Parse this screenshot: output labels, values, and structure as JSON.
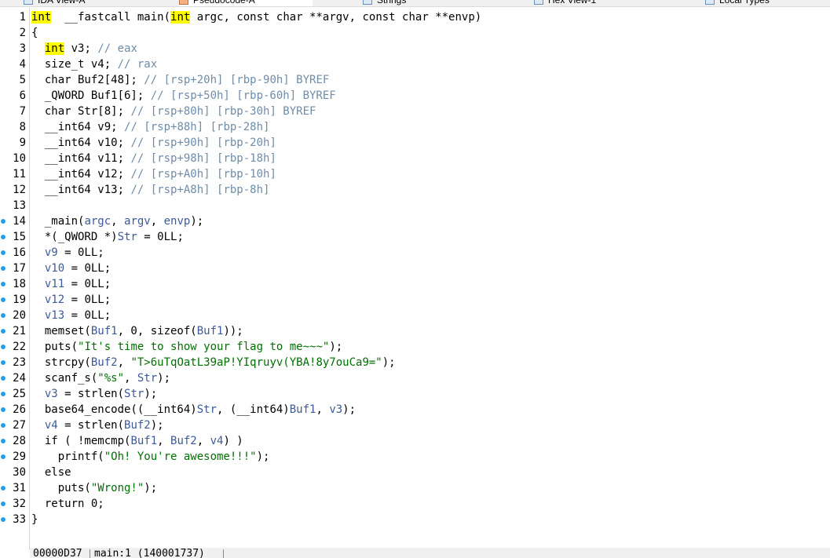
{
  "tabs": [
    {
      "label": "IDA View-A",
      "active": false
    },
    {
      "label": "Pseudocode-A",
      "active": true
    },
    {
      "label": "Strings",
      "active": false
    },
    {
      "label": "Hex View-1",
      "active": false
    },
    {
      "label": "Local Types",
      "active": false
    }
  ],
  "code": {
    "lines": [
      {
        "n": "1",
        "bp": false,
        "segs": [
          [
            "hl",
            "int"
          ],
          [
            "",
            "  __fastcall main("
          ],
          [
            "hl",
            "int"
          ],
          [
            "",
            " argc, const char **argv, const char **envp)"
          ]
        ]
      },
      {
        "n": "2",
        "bp": false,
        "segs": [
          [
            "",
            "{"
          ]
        ]
      },
      {
        "n": "3",
        "bp": false,
        "segs": [
          [
            "",
            "  "
          ],
          [
            "hl",
            "int"
          ],
          [
            "",
            " v3; "
          ],
          [
            "cmt",
            "// eax"
          ]
        ]
      },
      {
        "n": "4",
        "bp": false,
        "segs": [
          [
            "",
            "  size_t v4; "
          ],
          [
            "cmt",
            "// rax"
          ]
        ]
      },
      {
        "n": "5",
        "bp": false,
        "segs": [
          [
            "",
            "  char Buf2[48]; "
          ],
          [
            "cmt",
            "// [rsp+20h] [rbp-90h] BYREF"
          ]
        ]
      },
      {
        "n": "6",
        "bp": false,
        "segs": [
          [
            "",
            "  _QWORD Buf1[6]; "
          ],
          [
            "cmt",
            "// [rsp+50h] [rbp-60h] BYREF"
          ]
        ]
      },
      {
        "n": "7",
        "bp": false,
        "segs": [
          [
            "",
            "  char Str[8]; "
          ],
          [
            "cmt",
            "// [rsp+80h] [rbp-30h] BYREF"
          ]
        ]
      },
      {
        "n": "8",
        "bp": false,
        "segs": [
          [
            "",
            "  __int64 v9; "
          ],
          [
            "cmt",
            "// [rsp+88h] [rbp-28h]"
          ]
        ]
      },
      {
        "n": "9",
        "bp": false,
        "segs": [
          [
            "",
            "  __int64 v10; "
          ],
          [
            "cmt",
            "// [rsp+90h] [rbp-20h]"
          ]
        ]
      },
      {
        "n": "10",
        "bp": false,
        "segs": [
          [
            "",
            "  __int64 v11; "
          ],
          [
            "cmt",
            "// [rsp+98h] [rbp-18h]"
          ]
        ]
      },
      {
        "n": "11",
        "bp": false,
        "segs": [
          [
            "",
            "  __int64 v12; "
          ],
          [
            "cmt",
            "// [rsp+A0h] [rbp-10h]"
          ]
        ]
      },
      {
        "n": "12",
        "bp": false,
        "segs": [
          [
            "",
            "  __int64 v13; "
          ],
          [
            "cmt",
            "// [rsp+A8h] [rbp-8h]"
          ]
        ]
      },
      {
        "n": "13",
        "bp": false,
        "segs": []
      },
      {
        "n": "14",
        "bp": true,
        "segs": [
          [
            "",
            "  _main("
          ],
          [
            "var",
            "argc"
          ],
          [
            "",
            ", "
          ],
          [
            "var",
            "argv"
          ],
          [
            "",
            ", "
          ],
          [
            "var",
            "envp"
          ],
          [
            "",
            ");"
          ]
        ]
      },
      {
        "n": "15",
        "bp": true,
        "segs": [
          [
            "",
            "  *(_QWORD *)"
          ],
          [
            "var",
            "Str"
          ],
          [
            "",
            " = 0LL;"
          ]
        ]
      },
      {
        "n": "16",
        "bp": true,
        "segs": [
          [
            "",
            "  "
          ],
          [
            "var",
            "v9"
          ],
          [
            "",
            " = 0LL;"
          ]
        ]
      },
      {
        "n": "17",
        "bp": true,
        "segs": [
          [
            "",
            "  "
          ],
          [
            "var",
            "v10"
          ],
          [
            "",
            " = 0LL;"
          ]
        ]
      },
      {
        "n": "18",
        "bp": true,
        "segs": [
          [
            "",
            "  "
          ],
          [
            "var",
            "v11"
          ],
          [
            "",
            " = 0LL;"
          ]
        ]
      },
      {
        "n": "19",
        "bp": true,
        "segs": [
          [
            "",
            "  "
          ],
          [
            "var",
            "v12"
          ],
          [
            "",
            " = 0LL;"
          ]
        ]
      },
      {
        "n": "20",
        "bp": true,
        "segs": [
          [
            "",
            "  "
          ],
          [
            "var",
            "v13"
          ],
          [
            "",
            " = 0LL;"
          ]
        ]
      },
      {
        "n": "21",
        "bp": true,
        "segs": [
          [
            "",
            "  memset("
          ],
          [
            "var",
            "Buf1"
          ],
          [
            "",
            ", 0, sizeof("
          ],
          [
            "var",
            "Buf1"
          ],
          [
            "",
            "));"
          ]
        ]
      },
      {
        "n": "22",
        "bp": true,
        "segs": [
          [
            "",
            "  puts("
          ],
          [
            "str",
            "\"It's time to show your flag to me~~~\""
          ],
          [
            "",
            ");"
          ]
        ]
      },
      {
        "n": "23",
        "bp": true,
        "segs": [
          [
            "",
            "  strcpy("
          ],
          [
            "var",
            "Buf2"
          ],
          [
            "",
            ", "
          ],
          [
            "str",
            "\"T>6uTqOatL39aP!YIqruyv(YBA!8y7ouCa9=\""
          ],
          [
            "",
            ");"
          ]
        ]
      },
      {
        "n": "24",
        "bp": true,
        "segs": [
          [
            "",
            "  scanf_s("
          ],
          [
            "str",
            "\"%s\""
          ],
          [
            "",
            ", "
          ],
          [
            "var",
            "Str"
          ],
          [
            "",
            ");"
          ]
        ]
      },
      {
        "n": "25",
        "bp": true,
        "segs": [
          [
            "",
            "  "
          ],
          [
            "var",
            "v3"
          ],
          [
            "",
            " = strlen("
          ],
          [
            "var",
            "Str"
          ],
          [
            "",
            ");"
          ]
        ]
      },
      {
        "n": "26",
        "bp": true,
        "segs": [
          [
            "",
            "  base64_encode((__int64)"
          ],
          [
            "var",
            "Str"
          ],
          [
            "",
            ", (__int64)"
          ],
          [
            "var",
            "Buf1"
          ],
          [
            "",
            ", "
          ],
          [
            "var",
            "v3"
          ],
          [
            "",
            ");"
          ]
        ]
      },
      {
        "n": "27",
        "bp": true,
        "segs": [
          [
            "",
            "  "
          ],
          [
            "var",
            "v4"
          ],
          [
            "",
            " = strlen("
          ],
          [
            "var",
            "Buf2"
          ],
          [
            "",
            ");"
          ]
        ]
      },
      {
        "n": "28",
        "bp": true,
        "segs": [
          [
            "",
            "  if ( !memcmp("
          ],
          [
            "var",
            "Buf1"
          ],
          [
            "",
            ", "
          ],
          [
            "var",
            "Buf2"
          ],
          [
            "",
            ", "
          ],
          [
            "var",
            "v4"
          ],
          [
            "",
            ") )"
          ]
        ]
      },
      {
        "n": "29",
        "bp": true,
        "segs": [
          [
            "",
            "    printf("
          ],
          [
            "str",
            "\"Oh! You're awesome!!!\""
          ],
          [
            "",
            ");"
          ]
        ]
      },
      {
        "n": "30",
        "bp": false,
        "segs": [
          [
            "",
            "  else"
          ]
        ]
      },
      {
        "n": "31",
        "bp": true,
        "segs": [
          [
            "",
            "    puts("
          ],
          [
            "str",
            "\"Wrong!\""
          ],
          [
            "",
            ");"
          ]
        ]
      },
      {
        "n": "32",
        "bp": true,
        "segs": [
          [
            "",
            "  return 0;"
          ]
        ]
      },
      {
        "n": "33",
        "bp": true,
        "segs": [
          [
            "",
            "}"
          ]
        ]
      }
    ]
  },
  "status": {
    "address": "00000D37",
    "location": "main:1 (140001737)"
  },
  "colors": {
    "keyword_highlight": "#ffff00",
    "comment": "#6f8ca8",
    "string": "#007000",
    "variable": "#3c5a99",
    "breakpoint_dot": "#1ea1ea"
  }
}
